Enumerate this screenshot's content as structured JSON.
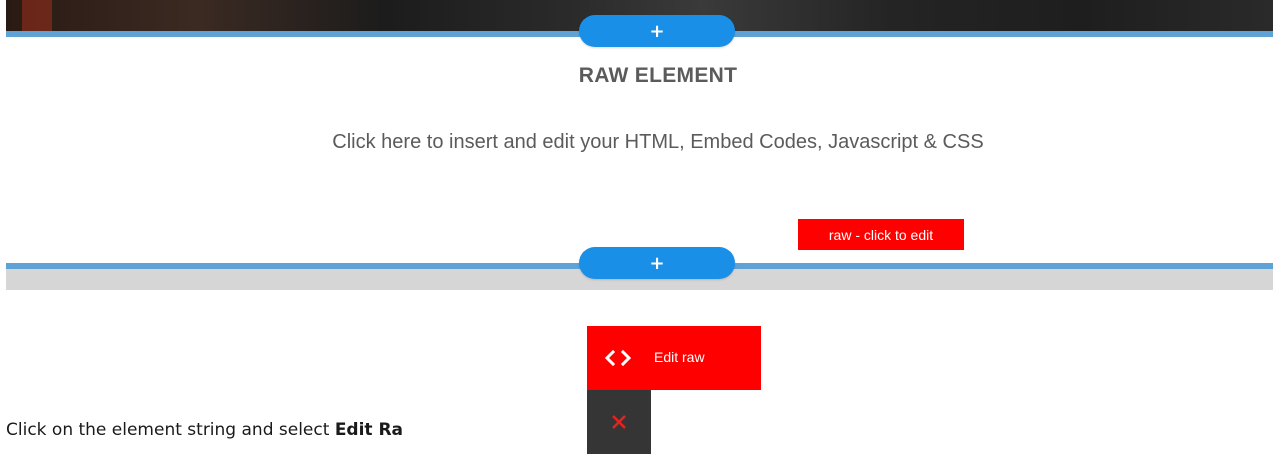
{
  "top_section": {
    "add_button_label": "+"
  },
  "raw_element": {
    "title": "RAW ELEMENT",
    "subtitle": "Click here to insert and edit your HTML, Embed Codes, Javascript & CSS",
    "tag_label": "raw - click to edit"
  },
  "bottom_section": {
    "add_button_label": "+"
  },
  "context_menu": {
    "edit_icon": "code-brackets-icon",
    "edit_icon_glyph": "‹›",
    "edit_label": "Edit raw",
    "delete_icon": "close-icon"
  },
  "caption": {
    "prefix": "Click on the element string and select ",
    "bold": "Edit Ra"
  },
  "colors": {
    "accent_blue": "#1a8fe8",
    "divider_blue": "#5fa2d6",
    "tag_red": "#ff0000",
    "dark_button": "#353535",
    "close_red": "#e8231f"
  }
}
